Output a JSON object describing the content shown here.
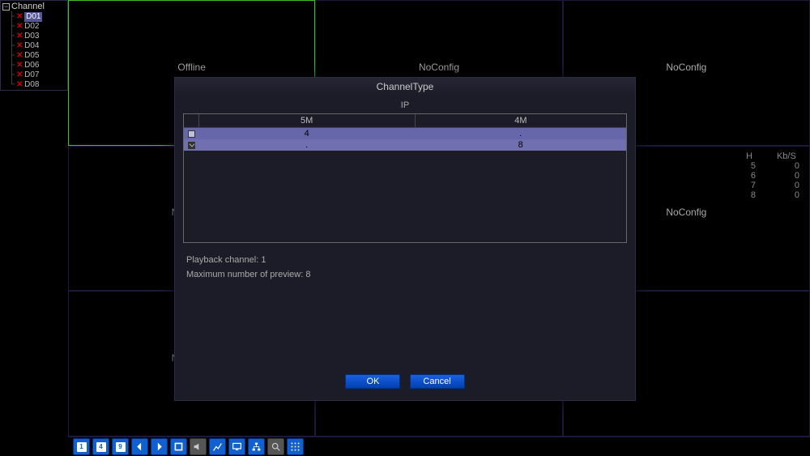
{
  "channel_panel": {
    "title": "Channel",
    "items": [
      {
        "label": "D01",
        "selected": true
      },
      {
        "label": "D02"
      },
      {
        "label": "D03"
      },
      {
        "label": "D04"
      },
      {
        "label": "D05"
      },
      {
        "label": "D06"
      },
      {
        "label": "D07"
      },
      {
        "label": "D08"
      }
    ]
  },
  "grid": {
    "cells": [
      {
        "status": "Offline",
        "selected": true
      },
      {
        "status": "NoConfig"
      },
      {
        "status": "NoConfig"
      },
      {
        "status": "NoConfig"
      },
      {
        "status": ""
      },
      {
        "status": "NoConfig"
      },
      {
        "status": "NoConfig"
      },
      {
        "status": ""
      },
      {
        "status": ""
      }
    ]
  },
  "stats": {
    "headers": [
      "H",
      "Kb/S"
    ],
    "rows": [
      {
        "h": "5",
        "kbs": "0"
      },
      {
        "h": "6",
        "kbs": "0"
      },
      {
        "h": "7",
        "kbs": "0"
      },
      {
        "h": "8",
        "kbs": "0"
      }
    ]
  },
  "dialog": {
    "title": "ChannelType",
    "sub": "IP",
    "columns": [
      "5M",
      "4M"
    ],
    "rows": [
      {
        "checked": false,
        "c1": "4",
        "c2": "."
      },
      {
        "checked": true,
        "c1": ".",
        "c2": "8"
      }
    ],
    "playback_line": "Playback channel: 1",
    "max_line": "Maximum number of preview: 8",
    "ok": "OK",
    "cancel": "Cancel"
  },
  "chart_data": {
    "type": "table",
    "title": "ChannelType",
    "columns": [
      "5M",
      "4M"
    ],
    "rows": [
      [
        "4",
        "."
      ],
      [
        ".",
        "8"
      ]
    ],
    "playback_channel": 1,
    "max_preview": 8
  },
  "toolbar": {
    "buttons": [
      {
        "name": "view-1-button",
        "kind": "num",
        "label": "1"
      },
      {
        "name": "view-4-button",
        "kind": "num",
        "label": "4"
      },
      {
        "name": "view-9-button",
        "kind": "num",
        "label": "9"
      },
      {
        "name": "prev-button",
        "kind": "arrow-left"
      },
      {
        "name": "next-button",
        "kind": "arrow-right"
      },
      {
        "name": "fullscreen-button",
        "kind": "square"
      },
      {
        "name": "volume-button",
        "kind": "speaker",
        "grey": true
      },
      {
        "name": "chart-button",
        "kind": "chart"
      },
      {
        "name": "monitor-button",
        "kind": "monitor"
      },
      {
        "name": "network-button",
        "kind": "network"
      },
      {
        "name": "search-button",
        "kind": "search",
        "grey": true
      },
      {
        "name": "grid-button",
        "kind": "dots"
      }
    ]
  }
}
